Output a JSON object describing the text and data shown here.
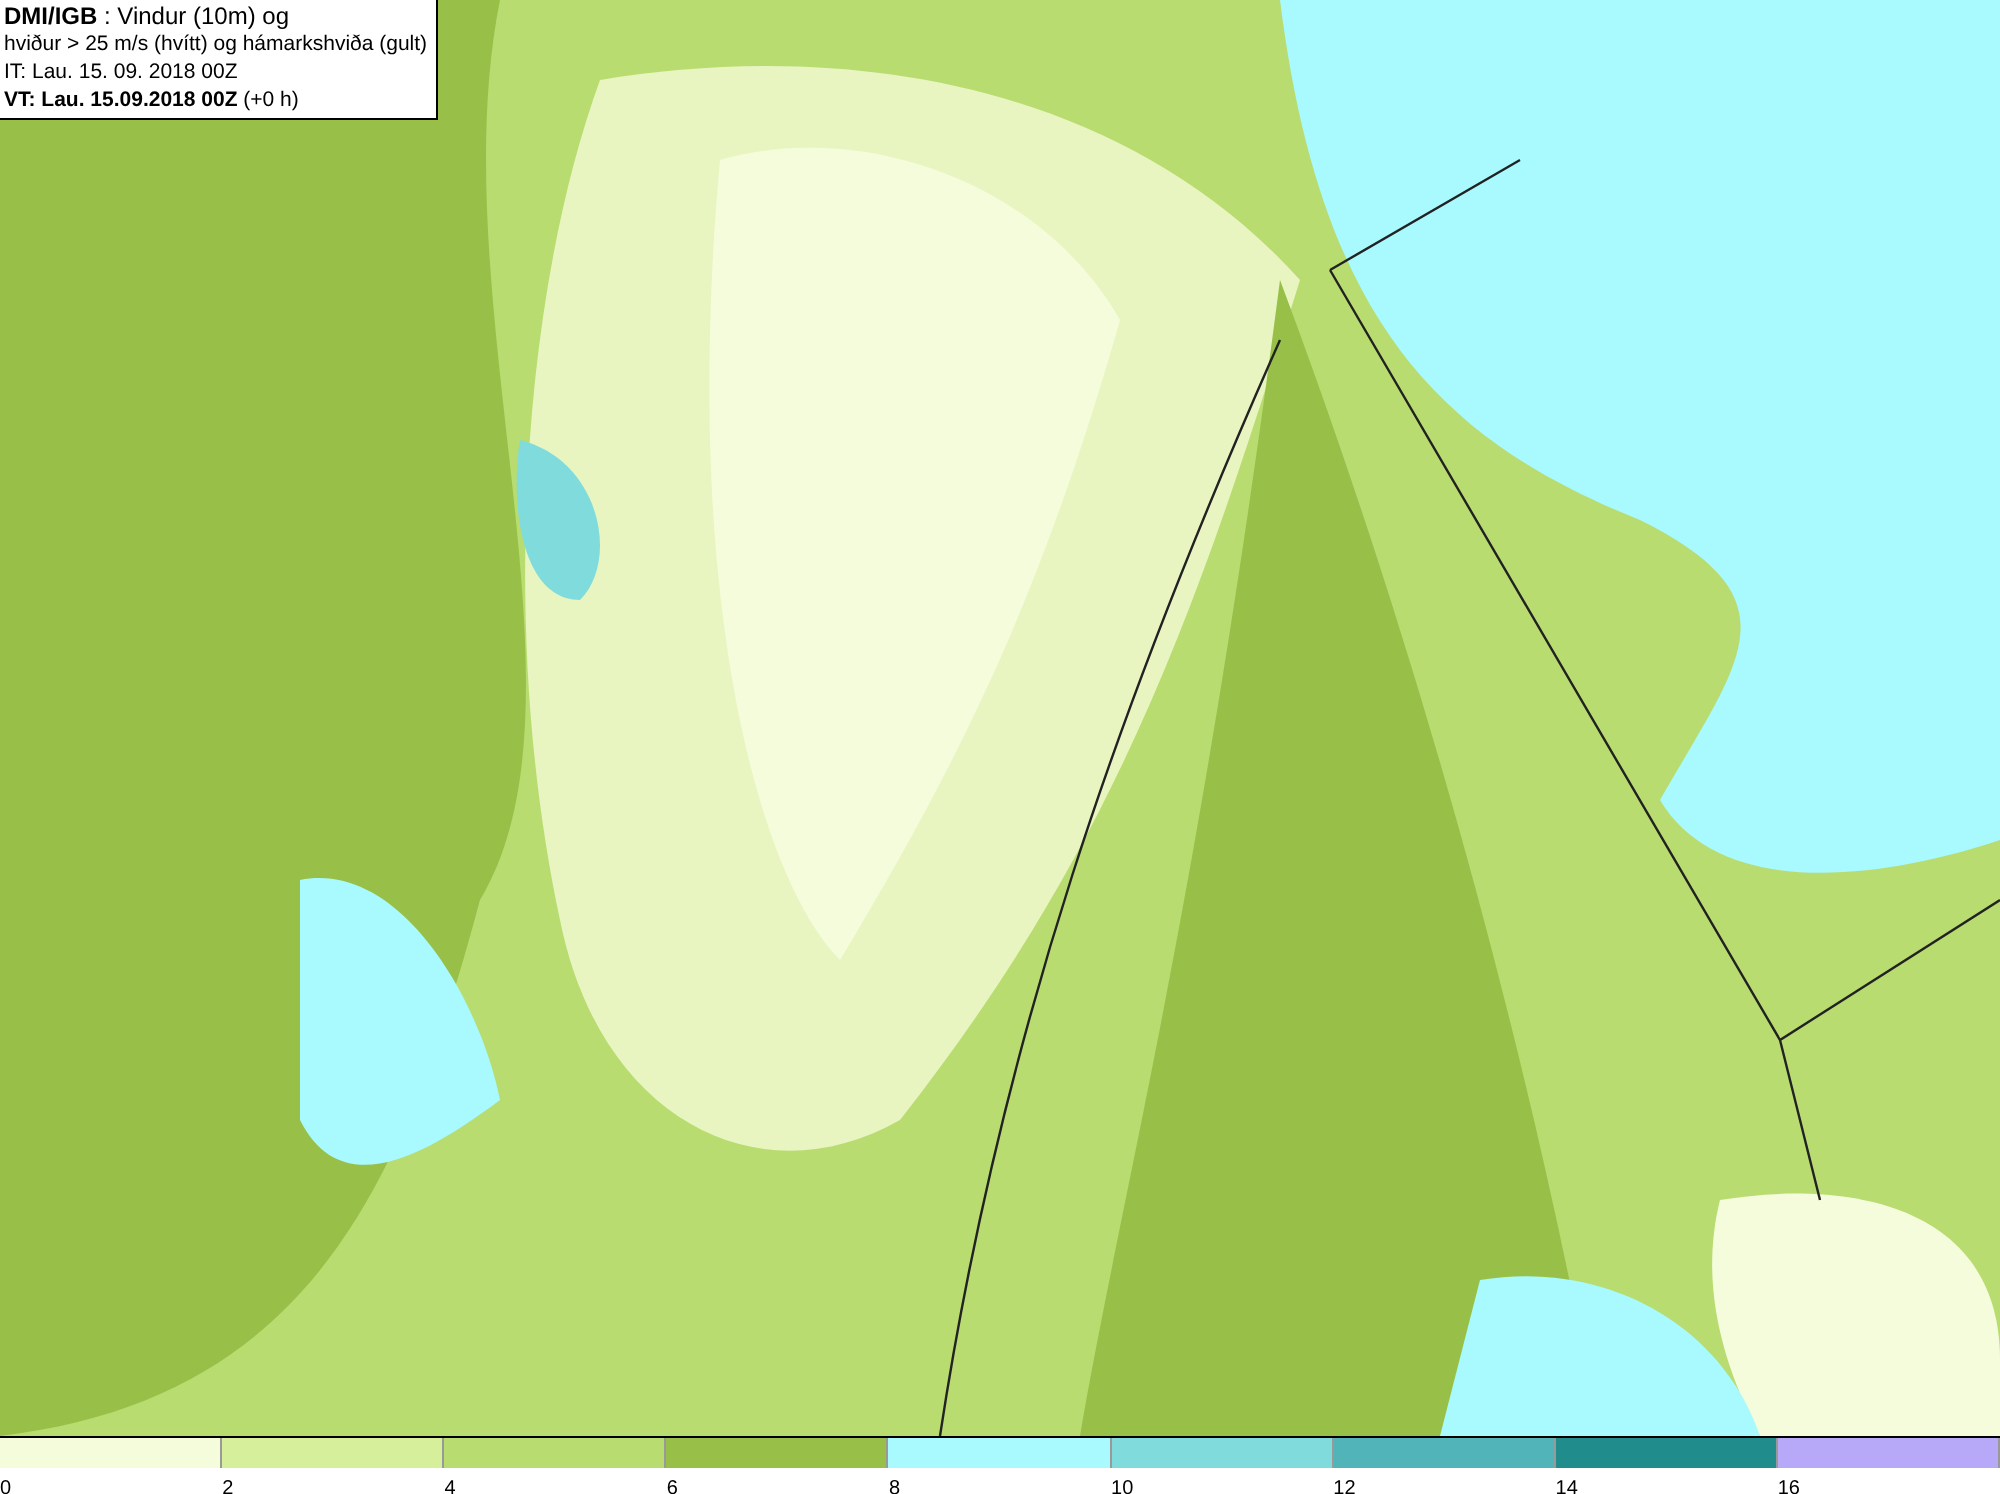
{
  "header": {
    "lines": [
      "**DMI/IGB** : Vindur (10m) og",
      "hviður > 25 m/s (hvítt) og hámarkshviða (gult)",
      "IT: Lau. 15. 09. 2018 00Z",
      "**VT: Lau. 15.09.2018 00Z** (+0 h)"
    ]
  },
  "legend": [
    {
      "color": "#f5fcdc",
      "label": "0"
    },
    {
      "color": "#d6ef9a",
      "label": "2"
    },
    {
      "color": "#b8dc70",
      "label": "4"
    },
    {
      "color": "#98c048",
      "label": "6"
    },
    {
      "color": "#a8faff",
      "label": "8"
    },
    {
      "color": "#80dcdc",
      "label": "10"
    },
    {
      "color": "#50b4b8",
      "label": "12"
    },
    {
      "color": "#208c8c",
      "label": "14"
    },
    {
      "color": "#b8a8f8",
      "label": "16"
    }
  ]
}
